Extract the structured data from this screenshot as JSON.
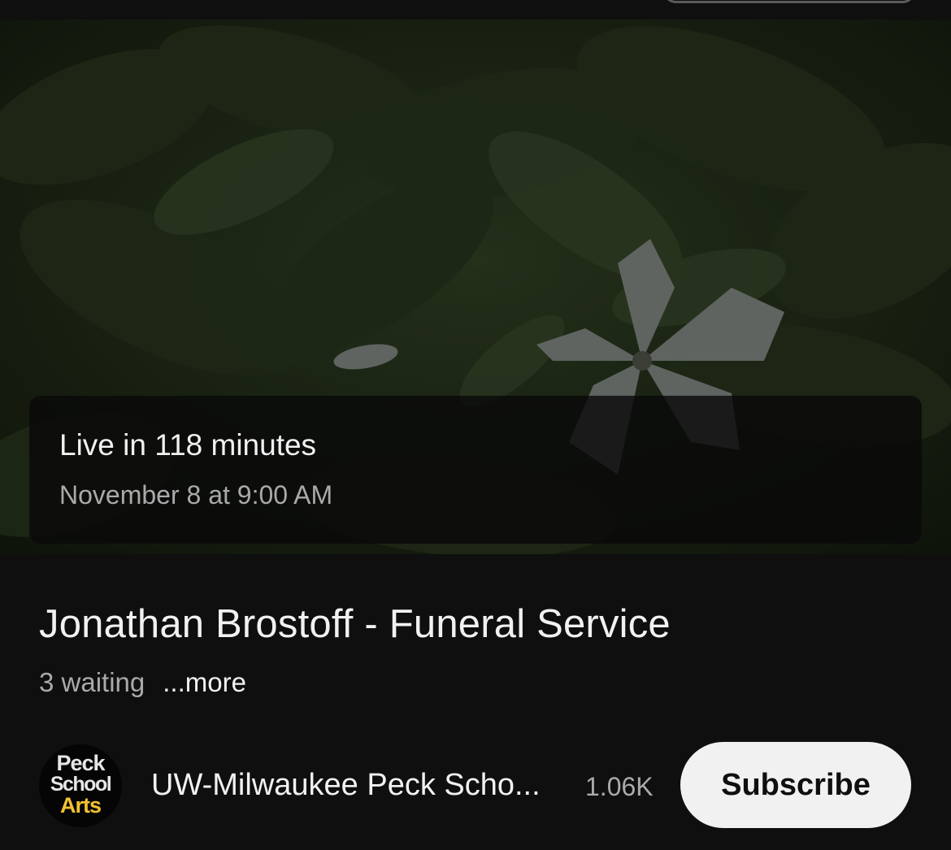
{
  "live_banner": {
    "status": "Live in 118 minutes",
    "scheduled": "November 8 at 9:00 AM"
  },
  "video": {
    "title": "Jonathan Brostoff - Funeral Service",
    "waiting": "3 waiting",
    "more_label": "...more"
  },
  "channel": {
    "name": "UW-Milwaukee Peck Scho...",
    "subscriber_count": "1.06K",
    "avatar_logo": [
      "Peck",
      "School",
      "Arts"
    ],
    "subscribe_label": "Subscribe"
  },
  "colors": {
    "background": "#0f0f0f",
    "text_primary": "#f1f1f1",
    "text_secondary": "#aaaaaa",
    "subscribe_bg": "#f1f1f1",
    "logo_accent": "#f2c230"
  }
}
